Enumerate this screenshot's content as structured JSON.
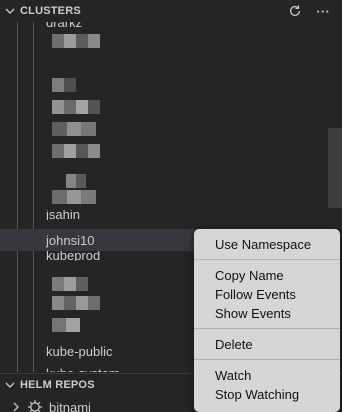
{
  "clusters_header": {
    "title": "CLUSTERS",
    "refresh_icon": "refresh-icon",
    "more_icon": "more-actions-icon",
    "more_glyph": "···"
  },
  "tree": {
    "partial_top_label": "drarkz",
    "items": [
      {
        "label": "johnsi10",
        "highlighted": true
      },
      {
        "label": "kube-public",
        "highlighted": false
      },
      {
        "label": "kube-system",
        "highlighted": false
      }
    ],
    "partial_labels": [
      "jsahin",
      "kubeprod"
    ]
  },
  "helm_header": {
    "title": "HELM REPOS"
  },
  "helm_repos": [
    {
      "label": "bitnami",
      "icon": "helm-icon"
    }
  ],
  "context_menu": {
    "groups": [
      [
        "Use Namespace"
      ],
      [
        "Copy Name",
        "Follow Events",
        "Show Events"
      ],
      [
        "Delete"
      ],
      [
        "Watch",
        "Stop Watching"
      ]
    ]
  },
  "colors": {
    "background": "#252526",
    "selection": "#37373d",
    "menu_background": "#d6d6d6",
    "text": "#cccccc"
  }
}
